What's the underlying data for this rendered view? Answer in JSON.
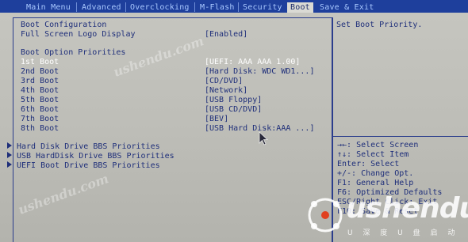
{
  "menubar": {
    "tabs": [
      {
        "label": "Main Menu"
      },
      {
        "label": "Advanced"
      },
      {
        "label": "Overclocking"
      },
      {
        "label": "M-Flash"
      },
      {
        "label": "Security"
      },
      {
        "label": "Boot"
      },
      {
        "label": "Save & Exit"
      }
    ],
    "active_tab": "Boot"
  },
  "main": {
    "boot_config_heading": "Boot Configuration",
    "full_screen_logo": {
      "label": "Full Screen Logo Display",
      "value": "[Enabled]"
    },
    "priorities_heading": "Boot Option Priorities",
    "boot_options": [
      {
        "label": "1st Boot",
        "value": "[UEFI: AAA AAA 1.00]",
        "selected": true
      },
      {
        "label": "2nd Boot",
        "value": "[Hard Disk: WDC WD1...]"
      },
      {
        "label": "3rd Boot",
        "value": "[CD/DVD]"
      },
      {
        "label": "4th Boot",
        "value": "[Network]"
      },
      {
        "label": "5th Boot",
        "value": "[USB Floppy]"
      },
      {
        "label": "6th Boot",
        "value": "[USB CD/DVD]"
      },
      {
        "label": "7th Boot",
        "value": "[BEV]"
      },
      {
        "label": "8th Boot",
        "value": "[USB Hard Disk:AAA ...]"
      }
    ],
    "submenus": [
      {
        "label": "Hard Disk Drive BBS Priorities"
      },
      {
        "label": "USB HardDisk Drive BBS Priorities"
      },
      {
        "label": "UEFI Boot Drive BBS Priorities"
      }
    ]
  },
  "help": {
    "text": "Set Boot Priority."
  },
  "keyhints": [
    {
      "text": "→←: Select Screen"
    },
    {
      "text": "↑↓: Select Item"
    },
    {
      "text": "Enter: Select"
    },
    {
      "text": "+/-: Change Opt."
    },
    {
      "text": "F1: General Help"
    },
    {
      "text": "F6: Optimized Defaults"
    },
    {
      "text": "ESC/Right Click: Exit"
    },
    {
      "text": "F10: Save & Reset"
    }
  ],
  "watermark": {
    "brand": "ushendu",
    "sub": "U 深 度 U 盘 启 动",
    "faint": "ushendu.com"
  },
  "colors": {
    "menubar_bg": "#1e3f9c",
    "panel_bg": "#c2c2bc",
    "text": "#1f2f7a",
    "selected_text": "#ffffff"
  }
}
